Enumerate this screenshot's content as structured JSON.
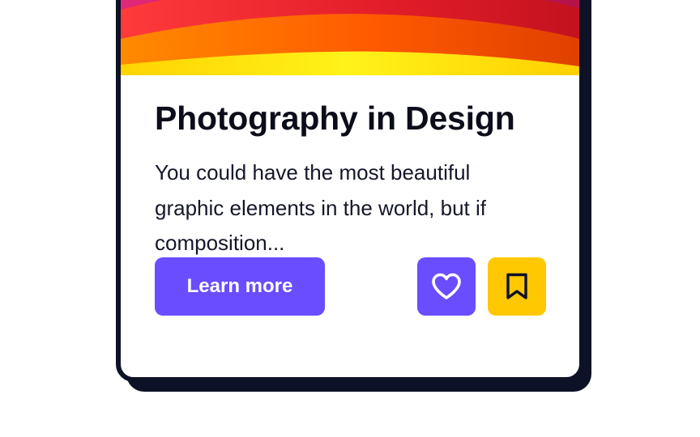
{
  "card": {
    "title": "Photography in Design",
    "description": "You could have the most beautiful graphic elements in the world, but if composition...",
    "primary_button_label": "Learn more",
    "like_icon": "heart-icon",
    "save_icon": "bookmark-icon"
  },
  "colors": {
    "accent": "#6a4dff",
    "save": "#ffc800",
    "outline": "#0d1226"
  }
}
